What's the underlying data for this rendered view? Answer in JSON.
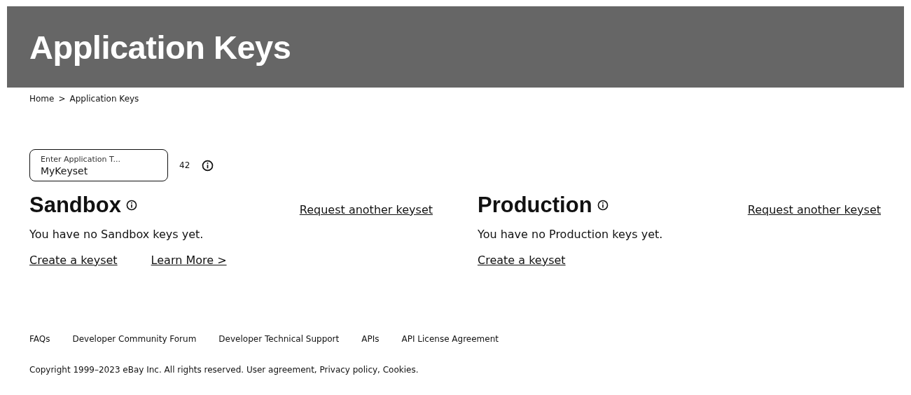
{
  "header": {
    "title": "Application Keys"
  },
  "breadcrumb": [
    {
      "label": "Home"
    },
    {
      "label": "Application Keys"
    }
  ],
  "breadcrumb_separator": ">",
  "app_title_field": {
    "placeholder": "Enter Application T...",
    "value": "MyKeyset",
    "counter": "42"
  },
  "environments": [
    {
      "title": "Sandbox",
      "request_link": "Request another keyset",
      "message": "You have no Sandbox keys yet.",
      "links": [
        "Create a keyset",
        "Learn More >"
      ]
    },
    {
      "title": "Production",
      "request_link": "Request another keyset",
      "message": "You have no Production keys yet.",
      "links": [
        "Create a keyset"
      ]
    }
  ],
  "footer": {
    "links": [
      "FAQs",
      "Developer Community Forum",
      "Developer Technical Support",
      "APIs",
      "API License Agreement"
    ],
    "copyright": "Copyright 1999–2023 eBay Inc. All rights reserved. User agreement, Privacy policy, Cookies."
  }
}
